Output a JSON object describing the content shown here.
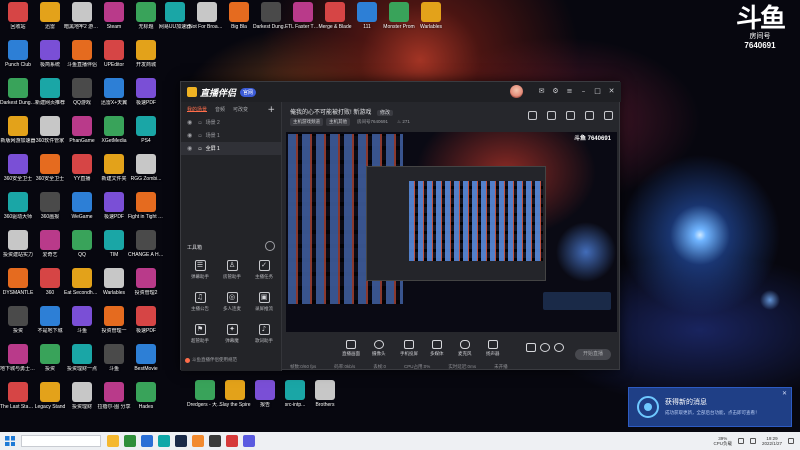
{
  "desktop": {
    "icons_left": [
      [
        "回收站",
        "Punch Club",
        "Darkest Dungeon®",
        "新版网游加速器",
        "360安全卫士",
        "360驱动大师",
        "投资建站实力",
        "DYSMANTLE",
        "投资",
        "地下城与勇士 命运",
        "The Last Stand A..."
      ],
      [
        "迅雷",
        "极简系统",
        "新建网页推荐",
        "360软件管家",
        "360安全卫士",
        "360画报",
        "爱奇艺",
        "360",
        "不是地下城",
        "投资",
        "Legacy Stand"
      ],
      [
        "暗黑地牢2 游戏代码",
        "斗鱼直播伴侣",
        "QQ游戏",
        "PhanGame",
        "YY直播",
        "WeGame",
        "QQ",
        "Eat Secondhand",
        "斗鱼",
        "投资理财一点",
        "投资理财"
      ],
      [
        "Steam",
        "UPEditor",
        "迅雷X+天翼",
        "XGetMedia",
        "新建文件夹",
        "极速PDF",
        "TIM",
        "Warlables",
        "投资管理一",
        "斗鱼",
        "拉蓓尔-图 分享"
      ],
      [
        "无标题",
        "开发商城",
        "极速PDF",
        "PS4",
        "RGG Zombi...",
        "Fight in Tight Spaces",
        "CHANGE A Homeless",
        "投资管理2",
        "极速PDF",
        "BestMovie",
        "Hades"
      ]
    ],
    "icons_top": [
      "网易UU加速器",
      "Not For Broadcast",
      "Big Bla",
      "Darkest Dungeon",
      "FTL Faster Than Light",
      "Merge & Blade",
      "111",
      "Monster Prom",
      "Warlables"
    ],
    "icons_bottom": [
      "Dredgers - 大型游戏工具",
      "Slay the Spire",
      "报告",
      "src-intp...",
      "Brothers"
    ],
    "logo_glyph": "斗鱼",
    "logo_sub": "房间号",
    "logo_num": "7640691"
  },
  "app": {
    "brand_name": "直播伴侣",
    "brand_version": "官网",
    "left_tabs": [
      "我的场景",
      "音频",
      "可改变"
    ],
    "scenes": [
      {
        "label": "场景 2"
      },
      {
        "label": "场景 1"
      },
      {
        "label": "全屏 1"
      }
    ],
    "tools_title": "工具箱",
    "tools": [
      "弹幕助手",
      "房管助手",
      "主播任务",
      "主播公告",
      "多人连麦",
      "录屏推流",
      "超管助手",
      "弹幕魔",
      "歌词助手",
      "投资帮助"
    ],
    "notice": "斗鱼直播伴侣使用规范",
    "room_title": "俺我的心不可能被打败! 新游戏",
    "room_edit": "修改",
    "room_tags": [
      "主机游戏频道",
      "主机其他"
    ],
    "room_id": "房间号7640691",
    "fire_count": "271",
    "preview_logo": "斗鱼 7640691",
    "bottom_tools": [
      "直播画面",
      "摄像头",
      "手机投屏",
      "多媒体",
      "麦克风",
      "扬声器"
    ],
    "start_label": "开始直播",
    "status": [
      "帧数:0/60 fps",
      "码率:0kb/s",
      "丢帧:0",
      "CPU占用:0%",
      "实时延迟:0ms",
      "未开播"
    ]
  },
  "toast": {
    "title": "获得新的消息",
    "body": "成功获取更新，全部后台功能，点击即可查看！"
  },
  "taskbar": {
    "cpu": "39%\nCPU负载",
    "time": "19:29",
    "date": "2022/1/27"
  }
}
